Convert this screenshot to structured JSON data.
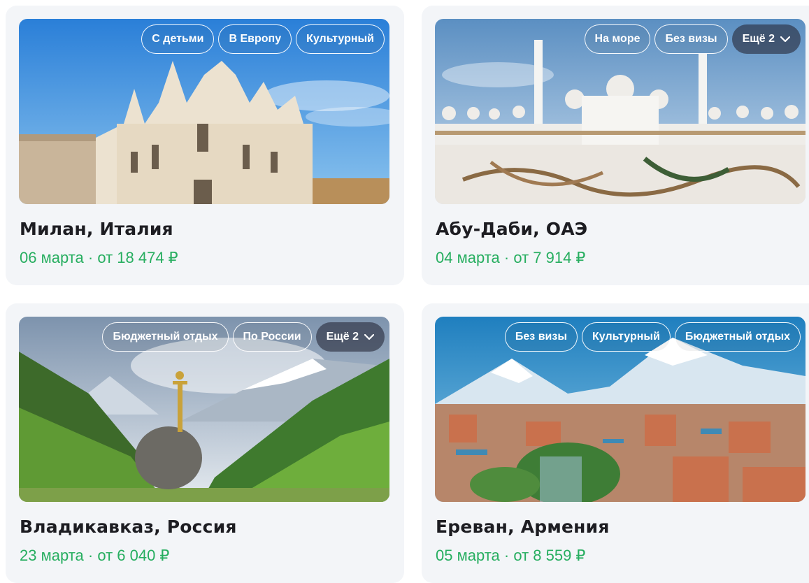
{
  "cards": [
    {
      "title": "Милан, Италия",
      "date": "06 марта",
      "separator": " · ",
      "price": "от 18 474 ₽",
      "tags": [
        "С детьми",
        "В Европу",
        "Культурный"
      ],
      "more_label": "",
      "image_icon": "cathedral-photo"
    },
    {
      "title": "Абу-Даби, ОАЭ",
      "date": "04 марта",
      "separator": " · ",
      "price": "от 7 914 ₽",
      "tags": [
        "На море",
        "Без визы"
      ],
      "more_label": "Ещё 2",
      "image_icon": "mosque-photo"
    },
    {
      "title": "Владикавказ, Россия",
      "date": "23 марта",
      "separator": " · ",
      "price": "от 6 040 ₽",
      "tags": [
        "Бюджетный отдых",
        "По России"
      ],
      "more_label": "Ещё 2",
      "image_icon": "mountain-sword-photo"
    },
    {
      "title": "Ереван, Армения",
      "date": "05 марта",
      "separator": " · ",
      "price": "от 8 559 ₽",
      "tags": [
        "Без визы",
        "Культурный",
        "Бюджетный отдых"
      ],
      "more_label": "",
      "image_icon": "city-mountain-photo"
    }
  ],
  "colors": {
    "card_bg": "#f3f5f8",
    "price_green": "#27ae60",
    "title_dark": "#1d1d22"
  }
}
